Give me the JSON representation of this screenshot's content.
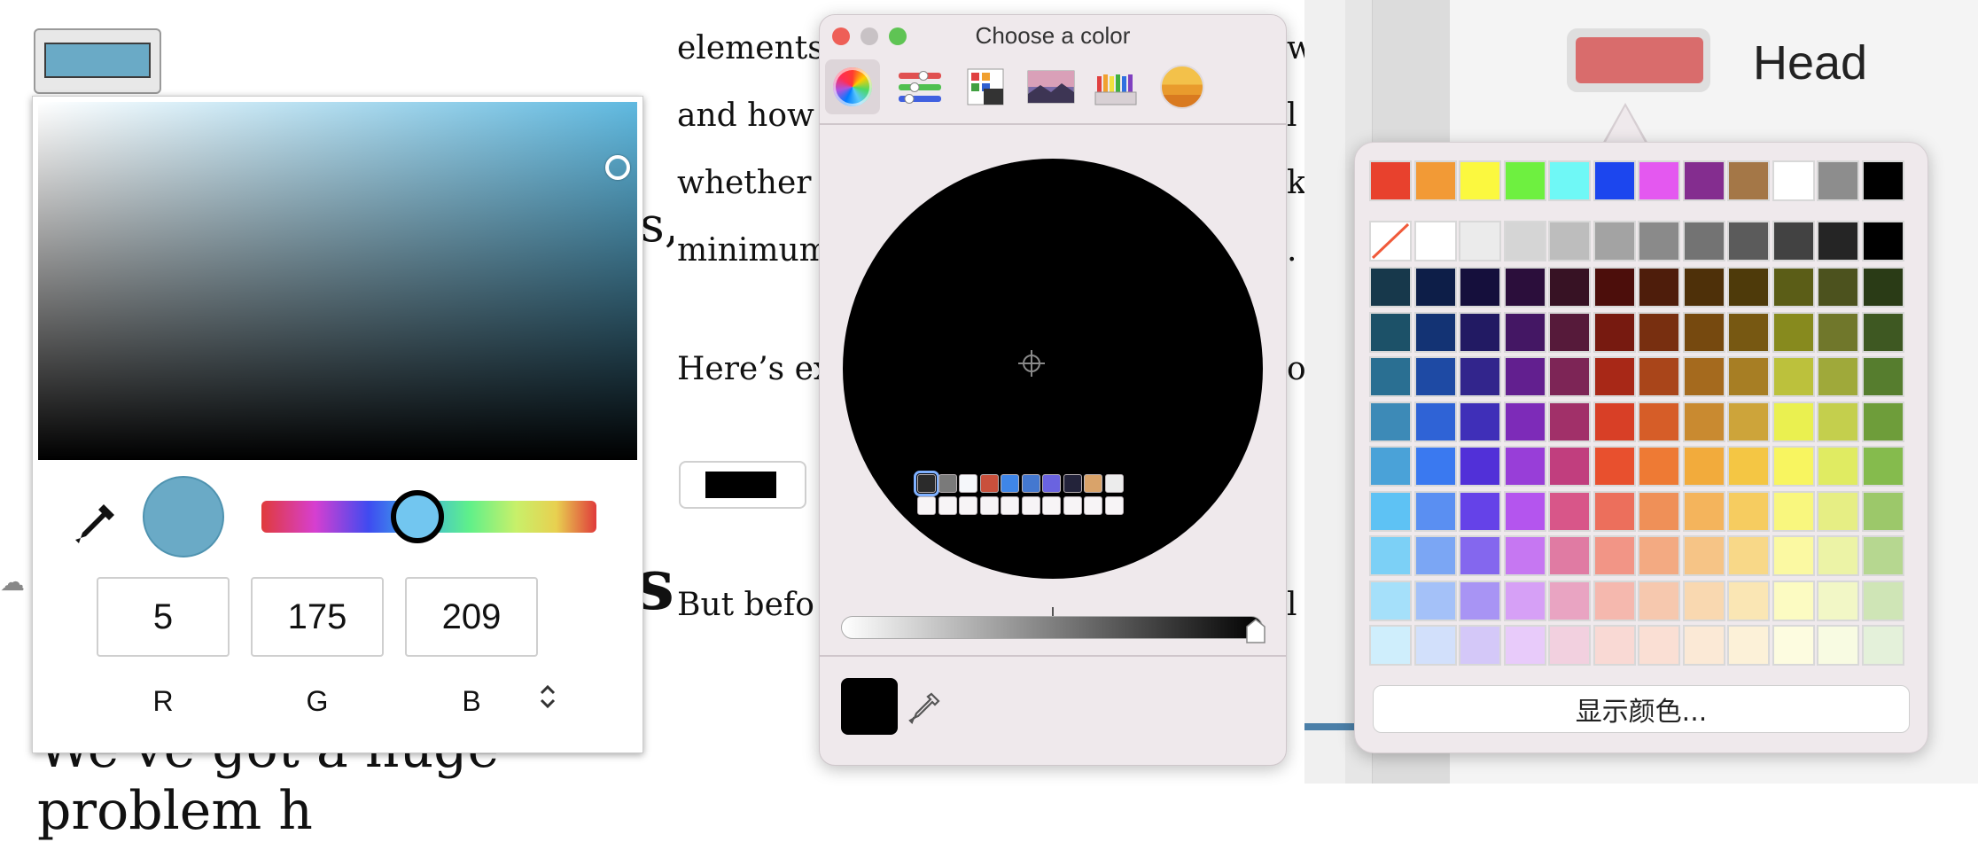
{
  "panel1": {
    "selected_color_hex": "#6aaac6",
    "rgb": {
      "r_value": "5",
      "g_value": "175",
      "b_value": "209",
      "r_label": "R",
      "g_label": "G",
      "b_label": "B"
    },
    "mode_toggle_icon": "up-down-chevron-icon",
    "background_text": {
      "fragment_a": "s,",
      "fragment_b": "s",
      "bottom_line": "We've got a huge problem h"
    }
  },
  "panel2": {
    "doc_lines": [
      "elements",
      "and how",
      "whether",
      "minimum",
      "Here’s ex",
      "But befo"
    ],
    "doc_right_fragments": [
      "w",
      "l",
      "k",
      ".",
      "ou",
      "l"
    ],
    "window_title": "Choose a color",
    "tools": [
      "color-wheel-icon",
      "sliders-icon",
      "palettes-icon",
      "image-palette-icon",
      "pencils-icon",
      "sunset-icon"
    ],
    "current_color_hex": "#000000",
    "saved_swatches": [
      "#2b2b2b",
      "#7a7a7a",
      "#f5f7fa",
      "#c9503c",
      "#3f86e8",
      "#4478d0",
      "#6a63e0",
      "#23233a",
      "#d9a36a",
      "#ececec"
    ]
  },
  "panel3": {
    "head_label": "Head",
    "head_color_hex": "#d96c6c",
    "top_row_colors": [
      "#e8412d",
      "#f29a36",
      "#fbf83f",
      "#6ef040",
      "#6ff8f6",
      "#1c46ee",
      "#e458f0",
      "#842d8f",
      "#a47747",
      "#ffffff",
      "#8d8d8d",
      "#000000"
    ],
    "gray_row_colors": [
      "none",
      "#ffffff",
      "#ebebeb",
      "#d5d5d5",
      "#bdbdbd",
      "#a3a3a3",
      "#8a8a8a",
      "#737373",
      "#5b5b5b",
      "#424242",
      "#252525",
      "#000000"
    ],
    "palette_rows": [
      [
        "#17384b",
        "#0d1e48",
        "#150f3c",
        "#2b0e3b",
        "#371224",
        "#4c0e0b",
        "#4e1d0b",
        "#4e3009",
        "#4e3a0a",
        "#5b5d17",
        "#4c521e",
        "#2a3b16"
      ],
      [
        "#1c5168",
        "#133374",
        "#221a63",
        "#441764",
        "#561a3a",
        "#771a10",
        "#782f10",
        "#76490f",
        "#775812",
        "#878a1e",
        "#70772b",
        "#3e5822"
      ],
      [
        "#2a6f92",
        "#1e4aa4",
        "#32258c",
        "#621f8f",
        "#7d2556",
        "#a82817",
        "#a9451a",
        "#a56a1e",
        "#a77e24",
        "#bcc13c",
        "#9fa93a",
        "#567d2e"
      ],
      [
        "#3d8ab7",
        "#2f63d6",
        "#3f2fb8",
        "#7d2bb8",
        "#a13069",
        "#d83f26",
        "#d65d28",
        "#c98a30",
        "#cda43a",
        "#eaf050",
        "#c4cf4d",
        "#6e9d3a"
      ],
      [
        "#4aa2d8",
        "#3a79f0",
        "#5130d8",
        "#983ed8",
        "#c13e7e",
        "#e8502e",
        "#ee7a34",
        "#f2ab3c",
        "#f4c644",
        "#f8f560",
        "#e0eb62",
        "#85bb4d"
      ],
      [
        "#5ec2f4",
        "#5a8ff2",
        "#6542e8",
        "#b455ee",
        "#d85689",
        "#ec6f5c",
        "#ef9058",
        "#f4b45c",
        "#f6cc60",
        "#f9f77e",
        "#e6ee84",
        "#9cc86a"
      ],
      [
        "#7cd0f6",
        "#7ba6f4",
        "#8467ee",
        "#c677f2",
        "#e07ba3",
        "#f29586",
        "#f3aa82",
        "#f6c486",
        "#f8d888",
        "#fbf9a2",
        "#ecf3a6",
        "#b6d790"
      ],
      [
        "#a5e0fa",
        "#a4c1f8",
        "#a894f4",
        "#d6a0f6",
        "#e9a4c2",
        "#f5b8ae",
        "#f6c8ae",
        "#f9d8b0",
        "#fae6b4",
        "#fcfbc2",
        "#f2f7c6",
        "#cfe5b6"
      ],
      [
        "#cfeefc",
        "#d2e0fb",
        "#d4c8f8",
        "#e8cbfa",
        "#f2d0df",
        "#f9d9d4",
        "#fadfd4",
        "#fbe9d6",
        "#fcf1d8",
        "#fdfce0",
        "#f8fbe2",
        "#e4f1da"
      ]
    ],
    "show_colors_label": "显示颜色..."
  }
}
